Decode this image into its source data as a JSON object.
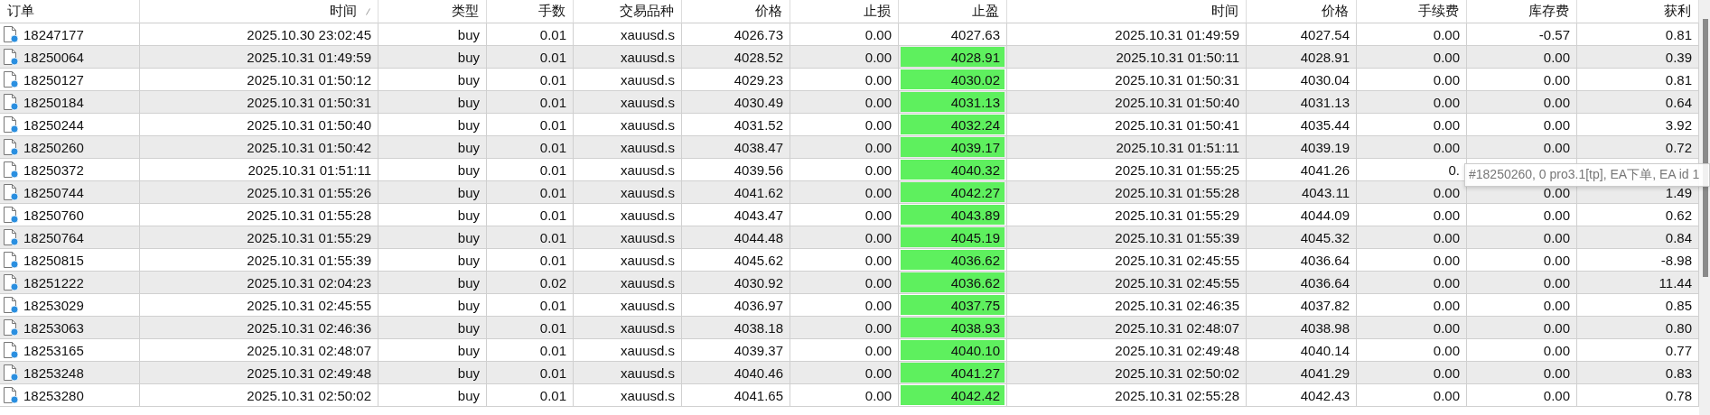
{
  "table": {
    "columns": [
      {
        "label": "订单",
        "sorted": false
      },
      {
        "label": "时间",
        "sorted": true
      },
      {
        "label": "类型",
        "sorted": false
      },
      {
        "label": "手数",
        "sorted": false
      },
      {
        "label": "交易品种",
        "sorted": false
      },
      {
        "label": "价格",
        "sorted": false
      },
      {
        "label": "止损",
        "sorted": false
      },
      {
        "label": "止盈",
        "sorted": false
      },
      {
        "label": "时间",
        "sorted": false
      },
      {
        "label": "价格",
        "sorted": false
      },
      {
        "label": "手续费",
        "sorted": false
      },
      {
        "label": "库存费",
        "sorted": false
      },
      {
        "label": "获利",
        "sorted": false
      }
    ],
    "rows": [
      {
        "tp_hit": false,
        "cells": [
          "18247177",
          "2025.10.30 23:02:45",
          "buy",
          "0.01",
          "xauusd.s",
          "4026.73",
          "0.00",
          "4027.63",
          "2025.10.31 01:49:59",
          "4027.54",
          "0.00",
          "-0.57",
          "0.81"
        ]
      },
      {
        "tp_hit": true,
        "cells": [
          "18250064",
          "2025.10.31 01:49:59",
          "buy",
          "0.01",
          "xauusd.s",
          "4028.52",
          "0.00",
          "4028.91",
          "2025.10.31 01:50:11",
          "4028.91",
          "0.00",
          "0.00",
          "0.39"
        ]
      },
      {
        "tp_hit": true,
        "cells": [
          "18250127",
          "2025.10.31 01:50:12",
          "buy",
          "0.01",
          "xauusd.s",
          "4029.23",
          "0.00",
          "4030.02",
          "2025.10.31 01:50:31",
          "4030.04",
          "0.00",
          "0.00",
          "0.81"
        ]
      },
      {
        "tp_hit": true,
        "cells": [
          "18250184",
          "2025.10.31 01:50:31",
          "buy",
          "0.01",
          "xauusd.s",
          "4030.49",
          "0.00",
          "4031.13",
          "2025.10.31 01:50:40",
          "4031.13",
          "0.00",
          "0.00",
          "0.64"
        ]
      },
      {
        "tp_hit": true,
        "cells": [
          "18250244",
          "2025.10.31 01:50:40",
          "buy",
          "0.01",
          "xauusd.s",
          "4031.52",
          "0.00",
          "4032.24",
          "2025.10.31 01:50:41",
          "4035.44",
          "0.00",
          "0.00",
          "3.92"
        ]
      },
      {
        "tp_hit": true,
        "cells": [
          "18250260",
          "2025.10.31 01:50:42",
          "buy",
          "0.01",
          "xauusd.s",
          "4038.47",
          "0.00",
          "4039.17",
          "2025.10.31 01:51:11",
          "4039.19",
          "0.00",
          "0.00",
          "0.72"
        ]
      },
      {
        "tp_hit": true,
        "cells": [
          "18250372",
          "2025.10.31 01:51:11",
          "buy",
          "0.01",
          "xauusd.s",
          "4039.56",
          "0.00",
          "4040.32",
          "2025.10.31 01:55:25",
          "4041.26",
          "0.",
          null,
          null
        ]
      },
      {
        "tp_hit": true,
        "cells": [
          "18250744",
          "2025.10.31 01:55:26",
          "buy",
          "0.01",
          "xauusd.s",
          "4041.62",
          "0.00",
          "4042.27",
          "2025.10.31 01:55:28",
          "4043.11",
          "0.00",
          "0.00",
          "1.49"
        ]
      },
      {
        "tp_hit": true,
        "cells": [
          "18250760",
          "2025.10.31 01:55:28",
          "buy",
          "0.01",
          "xauusd.s",
          "4043.47",
          "0.00",
          "4043.89",
          "2025.10.31 01:55:29",
          "4044.09",
          "0.00",
          "0.00",
          "0.62"
        ]
      },
      {
        "tp_hit": true,
        "cells": [
          "18250764",
          "2025.10.31 01:55:29",
          "buy",
          "0.01",
          "xauusd.s",
          "4044.48",
          "0.00",
          "4045.19",
          "2025.10.31 01:55:39",
          "4045.32",
          "0.00",
          "0.00",
          "0.84"
        ]
      },
      {
        "tp_hit": true,
        "cells": [
          "18250815",
          "2025.10.31 01:55:39",
          "buy",
          "0.01",
          "xauusd.s",
          "4045.62",
          "0.00",
          "4036.62",
          "2025.10.31 02:45:55",
          "4036.64",
          "0.00",
          "0.00",
          "-8.98"
        ]
      },
      {
        "tp_hit": true,
        "cells": [
          "18251222",
          "2025.10.31 02:04:23",
          "buy",
          "0.02",
          "xauusd.s",
          "4030.92",
          "0.00",
          "4036.62",
          "2025.10.31 02:45:55",
          "4036.64",
          "0.00",
          "0.00",
          "11.44"
        ]
      },
      {
        "tp_hit": true,
        "cells": [
          "18253029",
          "2025.10.31 02:45:55",
          "buy",
          "0.01",
          "xauusd.s",
          "4036.97",
          "0.00",
          "4037.75",
          "2025.10.31 02:46:35",
          "4037.82",
          "0.00",
          "0.00",
          "0.85"
        ]
      },
      {
        "tp_hit": true,
        "cells": [
          "18253063",
          "2025.10.31 02:46:36",
          "buy",
          "0.01",
          "xauusd.s",
          "4038.18",
          "0.00",
          "4038.93",
          "2025.10.31 02:48:07",
          "4038.98",
          "0.00",
          "0.00",
          "0.80"
        ]
      },
      {
        "tp_hit": true,
        "cells": [
          "18253165",
          "2025.10.31 02:48:07",
          "buy",
          "0.01",
          "xauusd.s",
          "4039.37",
          "0.00",
          "4040.10",
          "2025.10.31 02:49:48",
          "4040.14",
          "0.00",
          "0.00",
          "0.77"
        ]
      },
      {
        "tp_hit": true,
        "cells": [
          "18253248",
          "2025.10.31 02:49:48",
          "buy",
          "0.01",
          "xauusd.s",
          "4040.46",
          "0.00",
          "4041.27",
          "2025.10.31 02:50:02",
          "4041.29",
          "0.00",
          "0.00",
          "0.83"
        ]
      },
      {
        "tp_hit": true,
        "cells": [
          "18253280",
          "2025.10.31 02:50:02",
          "buy",
          "0.01",
          "xauusd.s",
          "4041.65",
          "0.00",
          "4042.42",
          "2025.10.31 02:55:28",
          "4042.43",
          "0.00",
          "0.00",
          "0.78"
        ]
      }
    ]
  },
  "tooltip": {
    "text": "#18250260, 0 pro3.1[tp], EA下单, EA id 1"
  }
}
